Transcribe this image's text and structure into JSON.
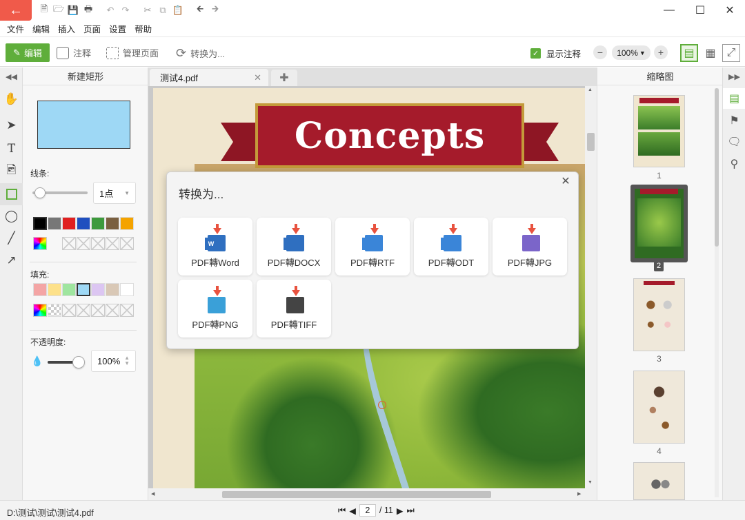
{
  "menu": [
    "文件",
    "编辑",
    "插入",
    "页面",
    "设置",
    "帮助"
  ],
  "toolbar": {
    "edit": "编辑",
    "annotate": "注释",
    "manage_pages": "管理页面",
    "convert": "转换为...",
    "show_notes": "显示注释",
    "zoom": "100%"
  },
  "properties": {
    "title": "新建矩形",
    "line_label": "线条:",
    "line_width": "1点",
    "fill_label": "填充:",
    "opacity_label": "不透明度:",
    "opacity_value": "100%",
    "line_colors": [
      "#000000",
      "#777777",
      "#e02020",
      "#1f4fbf",
      "#3d9a3d",
      "#7a6040",
      "#f4a300"
    ],
    "fill_colors": [
      "#f4a5a5",
      "#fde18a",
      "#9fe59f",
      "#9ed8f5",
      "#dcc6f2",
      "#d9c8b6",
      "#ffffff"
    ],
    "fill_selected": "#9ed8f5",
    "line_slider_level": 0.05,
    "opacity_slider_level": 1.0
  },
  "tab": {
    "name": "测试4.pdf"
  },
  "document": {
    "banner_title": "Concepts"
  },
  "dialog": {
    "title": "转换为...",
    "options": [
      {
        "label": "PDF轉Word",
        "tag": "W",
        "color": "#2f6fc0"
      },
      {
        "label": "PDF轉DOCX",
        "tag": "DOCX",
        "color": "#2f6fc0"
      },
      {
        "label": "PDF轉RTF",
        "tag": "RTF",
        "color": "#3a85d8"
      },
      {
        "label": "PDF轉ODT",
        "tag": "ODT",
        "color": "#3a85d8"
      },
      {
        "label": "PDF轉JPG",
        "tag": "",
        "color": "#7b65c9"
      },
      {
        "label": "PDF轉PNG",
        "tag": "",
        "color": "#3aa0d8"
      },
      {
        "label": "PDF轉TIFF",
        "tag": "",
        "color": "#444444"
      }
    ]
  },
  "thumbnails": {
    "title": "缩略图",
    "pages": [
      "1",
      "2",
      "3",
      "4"
    ]
  },
  "status": {
    "path": "D:\\测试\\测试\\测试4.pdf",
    "current_page": "2",
    "total_pages": "/ 11"
  }
}
